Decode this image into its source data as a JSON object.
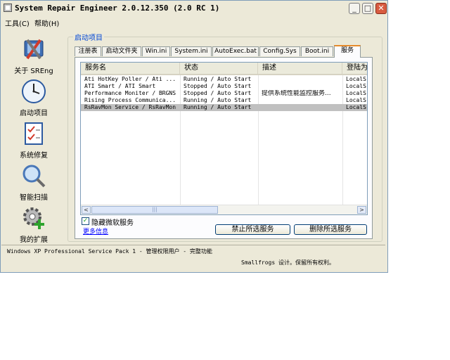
{
  "window": {
    "title": "System Repair Engineer 2.0.12.350 (2.0 RC 1)",
    "controls": {
      "minimize": "_",
      "maximize": "□",
      "close": "✕"
    }
  },
  "menu": [
    "工具(C)",
    "帮助(H)"
  ],
  "nav": [
    {
      "label": "关于 SREng",
      "icon": "tools-icon"
    },
    {
      "label": "启动项目",
      "icon": "clock-icon"
    },
    {
      "label": "系统修复",
      "icon": "checklist-icon"
    },
    {
      "label": "智能扫描",
      "icon": "magnifier-icon"
    },
    {
      "label": "我的扩展",
      "icon": "gear-plus-icon"
    }
  ],
  "group_title": "启动项目",
  "tabs": [
    "注册表",
    "启动文件夹",
    "Win.ini",
    "System.ini",
    "AutoExec.bat",
    "Config.Sys",
    "Boot.ini",
    "服务"
  ],
  "selected_tab": "服务",
  "columns": [
    "服务名",
    "状态",
    "描述",
    "登陆为"
  ],
  "rows": [
    {
      "name": "Ati HotKey Poller / Ati ...",
      "status": "Running / Auto Start",
      "desc": "",
      "logon": "LocalS"
    },
    {
      "name": "ATI Smart / ATI Smart",
      "status": "Stopped / Auto Start",
      "desc": "",
      "logon": "LocalS"
    },
    {
      "name": "Performance Moniter / BRGNS",
      "status": "Stopped / Auto Start",
      "desc": "提供系统性能监控服务...",
      "logon": "LocalS"
    },
    {
      "name": "Rising Process Communica...",
      "status": "Running / Auto Start",
      "desc": "",
      "logon": "LocalS"
    },
    {
      "name": "RsRavMon Service / RsRavMon",
      "status": "Running / Auto Start",
      "desc": "",
      "logon": "LocalS"
    }
  ],
  "scroll": {
    "left": "<",
    "right": ">",
    "thumb": "|||"
  },
  "hide_ms_services": {
    "label": "隐藏微软服务",
    "checked": true,
    "mark": "✓"
  },
  "more_info": "更多信息",
  "buttons": {
    "disable": "禁止所选服务",
    "delete": "删除所选服务"
  },
  "status": {
    "line1": "Windows XP Professional Service Pack 1 - 管理权限用户 - 完整功能",
    "line2": "Smallfrogs 设计。保留所有权利。"
  }
}
